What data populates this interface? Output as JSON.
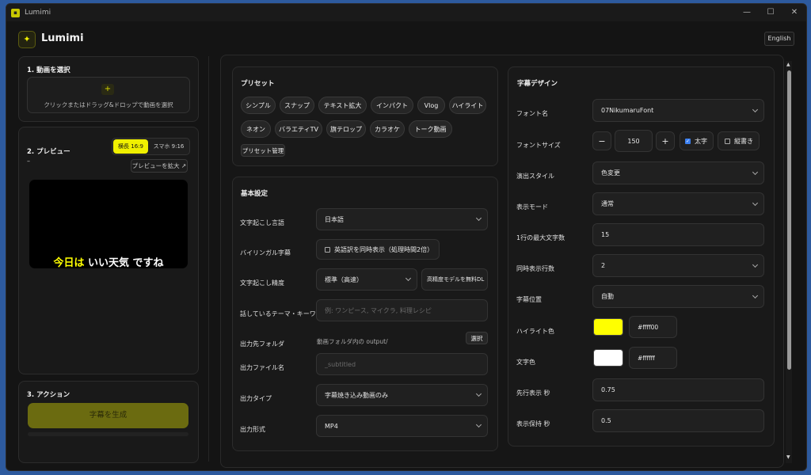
{
  "window": {
    "title": "Lumimi"
  },
  "header": {
    "app_name": "Lumimi",
    "language_button": "English"
  },
  "left": {
    "select": {
      "title": "1. 動画を選択",
      "plus": "+",
      "hint": "クリックまたはドラッグ&ドロップで動画を選択"
    },
    "preview": {
      "title": "2. プレビュー",
      "dash": "–",
      "aspect_landscape": "横長 16:9",
      "aspect_portrait": "スマホ 9:16",
      "expand": "プレビューを拡大 ↗",
      "caption_highlight": "今日は",
      "caption_rest": "いい天気 ですね"
    },
    "action": {
      "title": "3. アクション",
      "generate": "字幕を生成"
    }
  },
  "presets": {
    "title": "プリセット",
    "row1": [
      "シンプル",
      "スナップ",
      "テキスト拡大",
      "インパクト",
      "Vlog",
      "ハイライト"
    ],
    "row2": [
      "ネオン",
      "バラエティTV",
      "旗テロップ",
      "カラオケ",
      "トーク動画"
    ],
    "manage": "プリセット管理"
  },
  "basic": {
    "title": "基本設定",
    "language_label": "文字起こし言語",
    "language_value": "日本語",
    "bilingual_label": "バイリンガル字幕",
    "bilingual_option": "英語訳を同時表示（処理時間2倍）",
    "accuracy_label": "文字起こし精度",
    "accuracy_value": "標準（高速）",
    "accuracy_model_button": "高精度モデルを無料DL",
    "keywords_label": "話しているテーマ・キーワード",
    "keywords_placeholder": "例: ワンピース, マイクラ, 料理レシピ",
    "folder_label": "出力先フォルダ",
    "folder_value": "動画フォルダ内の output/",
    "folder_button": "選択",
    "filename_label": "出力ファイル名",
    "filename_placeholder": "_subtitled",
    "type_label": "出力タイプ",
    "type_value": "字幕焼き込み動画のみ",
    "format_label": "出力形式",
    "format_value": "MP4"
  },
  "design": {
    "title": "字幕デザイン",
    "font_label": "フォント名",
    "font_value": "07NikumaruFont",
    "size_label": "フォントサイズ",
    "size_minus": "−",
    "size_value": "150",
    "size_plus": "+",
    "bold_label": "太字",
    "vertical_label": "縦書き",
    "style_label": "演出スタイル",
    "style_value": "色変更",
    "mode_label": "表示モード",
    "mode_value": "通常",
    "max_chars_label": "1行の最大文字数",
    "max_chars_value": "15",
    "lines_label": "同時表示行数",
    "lines_value": "2",
    "position_label": "字幕位置",
    "position_value": "自動",
    "highlight_label": "ハイライト色",
    "highlight_value": "#ffff00",
    "text_color_label": "文字色",
    "text_color_value": "#ffffff",
    "lead_label": "先行表示 秒",
    "lead_value": "0.75",
    "hold_label": "表示保持 秒",
    "hold_value": "0.5"
  },
  "colors": {
    "accent": "#f0f000",
    "generate_bg": "#6b6b10",
    "highlight": "#ffff00",
    "text": "#ffffff"
  }
}
